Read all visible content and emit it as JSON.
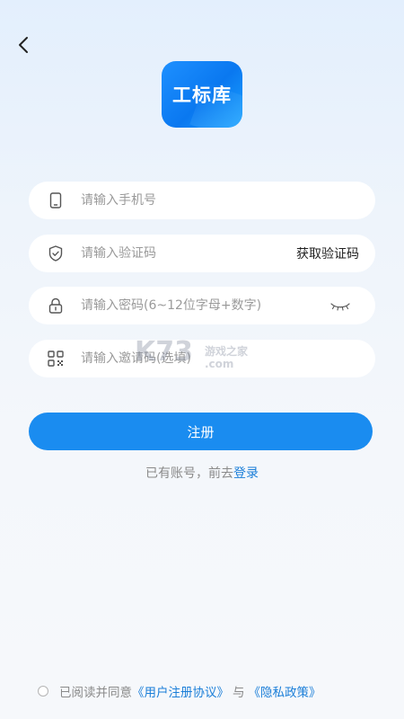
{
  "header": {
    "back_icon": "chevron-left-icon"
  },
  "logo": {
    "text": "工标库"
  },
  "form": {
    "phone": {
      "icon": "phone-icon",
      "placeholder": "请输入手机号",
      "value": ""
    },
    "code": {
      "icon": "shield-check-icon",
      "placeholder": "请输入验证码",
      "value": "",
      "action_label": "获取验证码"
    },
    "password": {
      "icon": "lock-icon",
      "placeholder": "请输入密码(6~12位字母+数字)",
      "value": "",
      "toggle_icon": "eye-closed-icon"
    },
    "invite": {
      "icon": "qr-code-icon",
      "placeholder": "请输入邀请码(选填)",
      "value": ""
    }
  },
  "register": {
    "label": "注册"
  },
  "login_prompt": {
    "text": "已有账号，前去",
    "link": "登录"
  },
  "agreement": {
    "prefix": "已阅读并同意",
    "user_agreement": "《用户注册协议》",
    "conjunction": "与",
    "privacy_policy": "《隐私政策》"
  },
  "watermark": {
    "brand": "K73",
    "tagline": "游戏之家",
    "domain": ".com"
  },
  "colors": {
    "primary": "#1a8cf0",
    "link": "#1a7ed8",
    "background": "#eef4fb"
  }
}
